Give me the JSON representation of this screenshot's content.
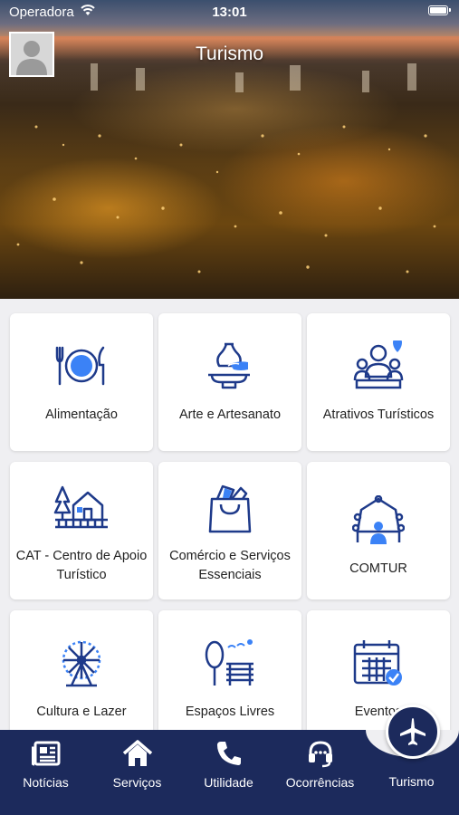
{
  "status": {
    "carrier": "Operadora",
    "time": "13:01"
  },
  "header": {
    "title": "Turismo"
  },
  "cards": [
    {
      "label": "Alimentação",
      "icon": "plate-cutlery-icon"
    },
    {
      "label": "Arte e Artesanato",
      "icon": "pottery-icon"
    },
    {
      "label": "Atrativos Turísticos",
      "icon": "tour-guide-icon"
    },
    {
      "label": "CAT - Centro de Apoio Turístico",
      "icon": "house-tree-icon"
    },
    {
      "label": "Comércio e Serviços Essenciais",
      "icon": "shopping-bag-icon"
    },
    {
      "label": "COMTUR",
      "icon": "meeting-table-icon"
    },
    {
      "label": "Cultura e Lazer",
      "icon": "ferris-wheel-icon"
    },
    {
      "label": "Espaços Livres",
      "icon": "park-bench-icon"
    },
    {
      "label": "Eventos",
      "icon": "calendar-check-icon"
    }
  ],
  "nav": [
    {
      "label": "Notícias",
      "icon": "newspaper-icon"
    },
    {
      "label": "Serviços",
      "icon": "home-icon"
    },
    {
      "label": "Utilidade",
      "icon": "phone-icon"
    },
    {
      "label": "Ocorrências",
      "icon": "headset-icon"
    },
    {
      "label": "Turismo",
      "icon": "airplane-icon"
    }
  ],
  "colors": {
    "navy": "#1c2a5c",
    "icon_blue": "#1e3a8a",
    "accent_blue": "#3b82f6"
  }
}
